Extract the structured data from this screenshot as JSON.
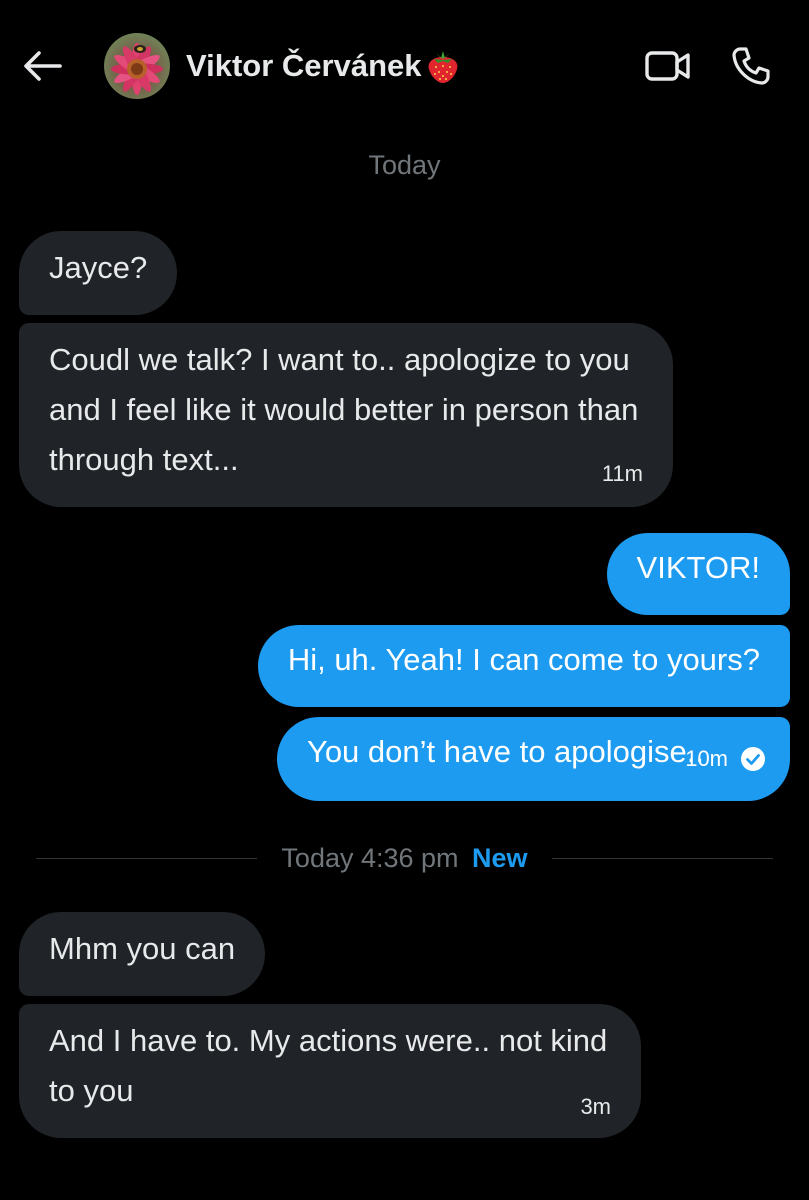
{
  "header": {
    "contact_name": "Viktor Červánek",
    "name_emoji": "strawberry",
    "icons": {
      "back": "back-arrow-icon",
      "video": "video-camera-icon",
      "call": "phone-icon"
    }
  },
  "conversation": {
    "date_label": "Today",
    "divider": {
      "label": "Today 4:36 pm",
      "new_label": "New"
    },
    "messages": [
      {
        "direction": "incoming",
        "text": "Jayce?"
      },
      {
        "direction": "incoming",
        "text": "Coudl we talk? I want to.. apologize to you and I feel like it would better in person than through text...",
        "time": "11m"
      },
      {
        "direction": "outgoing",
        "text": "VIKTOR!"
      },
      {
        "direction": "outgoing",
        "text": "Hi, uh. Yeah! I can come to yours?"
      },
      {
        "direction": "outgoing",
        "text": "You don’t have to apologise..",
        "time": "10m",
        "status": "read-check-icon"
      },
      {
        "direction": "incoming",
        "text": "Mhm you can"
      },
      {
        "direction": "incoming",
        "text": "And I have to. My actions were.. not kind to you",
        "time": "3m"
      }
    ]
  },
  "colors": {
    "background": "#000000",
    "incoming_bubble": "#202327",
    "outgoing_bubble": "#1d9bf0",
    "muted_text": "#71767b",
    "accent": "#1d9bf0"
  }
}
